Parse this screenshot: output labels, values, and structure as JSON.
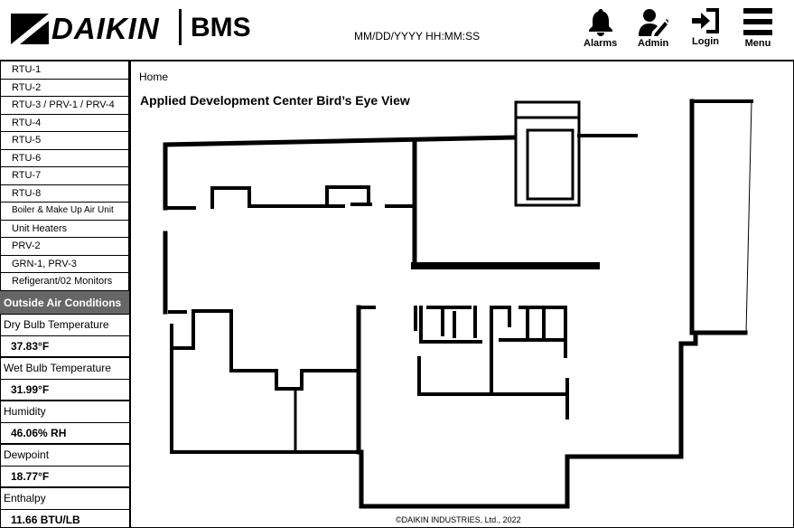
{
  "header": {
    "brand": "DAIKIN",
    "app_name": "BMS",
    "datetime": "MM/DD/YYYY HH:MM:SS",
    "buttons": {
      "alarms": "Alarms",
      "admin": "Admin",
      "login": "Login",
      "menu": "Menu"
    }
  },
  "sidebar": {
    "items": [
      "RTU-1",
      "RTU-2",
      "RTU-3 / PRV-1 / PRV-4",
      "RTU-4",
      "RTU-5",
      "RTU-6",
      "RTU-7",
      "RTU-8",
      "Boiler & Make Up Air Unit",
      "Unit Heaters",
      "PRV-2",
      "GRN-1, PRV-3",
      "Refigerant/02 Monitors"
    ],
    "outside_air": {
      "title": "Outside Air Conditions",
      "dry_bulb_label": "Dry Bulb Temperature",
      "dry_bulb_value": "37.83°F",
      "wet_bulb_label": "Wet Bulb Temperature",
      "wet_bulb_value": "31.99°F",
      "humidity_label": "Humidity",
      "humidity_value": "46.06% RH",
      "dewpoint_label": "Dewpoint",
      "dewpoint_value": "18.77°F",
      "enthalpy_label": "Enthalpy",
      "enthalpy_value": "11.66 BTU/LB"
    }
  },
  "main": {
    "breadcrumb": "Home",
    "title": "Applied Development Center Bird’s Eye View"
  },
  "footer": {
    "copyright": "©DAIKIN INDUSTRIES, Ltd., 2022"
  }
}
